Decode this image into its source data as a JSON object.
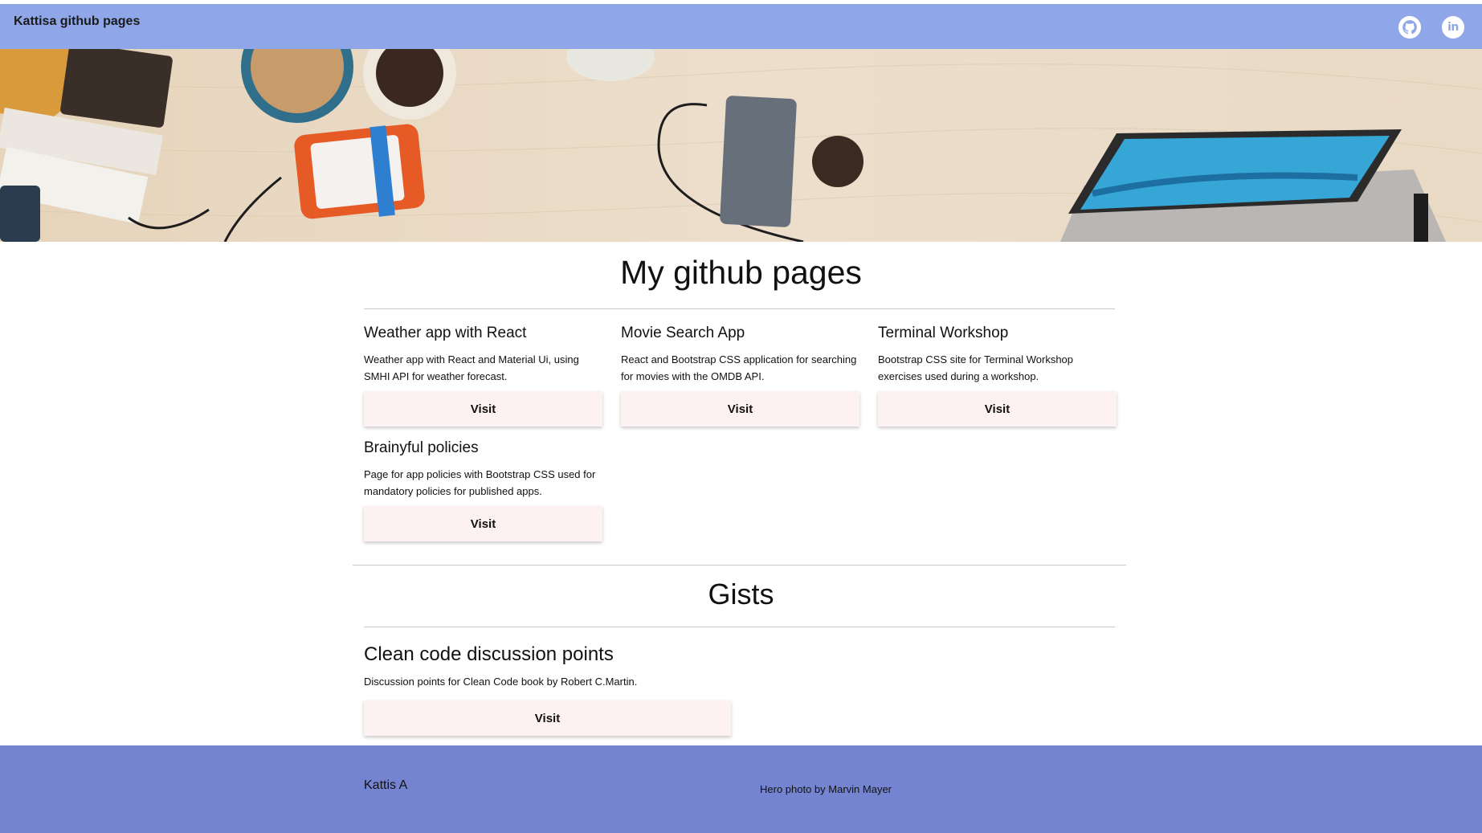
{
  "header": {
    "brand": "Kattisa github pages",
    "icons": [
      "github-icon",
      "linkedin-icon"
    ]
  },
  "hero": {
    "image": "desk-with-laptop-photo"
  },
  "pages_section": {
    "title": "My github pages",
    "cards": [
      {
        "title": "Weather app with React",
        "description": "Weather app with React and Material Ui, using SMHI API for weather forecast.",
        "button": "Visit"
      },
      {
        "title": "Movie Search App",
        "description": "React and Bootstrap CSS application for searching for movies with the OMDB API.",
        "button": "Visit"
      },
      {
        "title": "Terminal Workshop",
        "description": "Bootstrap CSS site for Terminal Workshop exercises used during a workshop.",
        "button": "Visit"
      },
      {
        "title": "Brainyful policies",
        "description": "Page for app policies with Bootstrap CSS used for mandatory policies for published apps.",
        "button": "Visit"
      }
    ]
  },
  "gists_section": {
    "title": "Gists",
    "items": [
      {
        "title": "Clean code discussion points",
        "description": "Discussion points for Clean Code book by Robert C.Martin.",
        "button": "Visit"
      }
    ]
  },
  "footer": {
    "name": "Kattis A",
    "credit": "Hero photo by Marvin Mayer"
  },
  "colors": {
    "navbar": "#8fa7e8",
    "footer": "#7584d1",
    "button_bg": "#fdf1f1"
  }
}
